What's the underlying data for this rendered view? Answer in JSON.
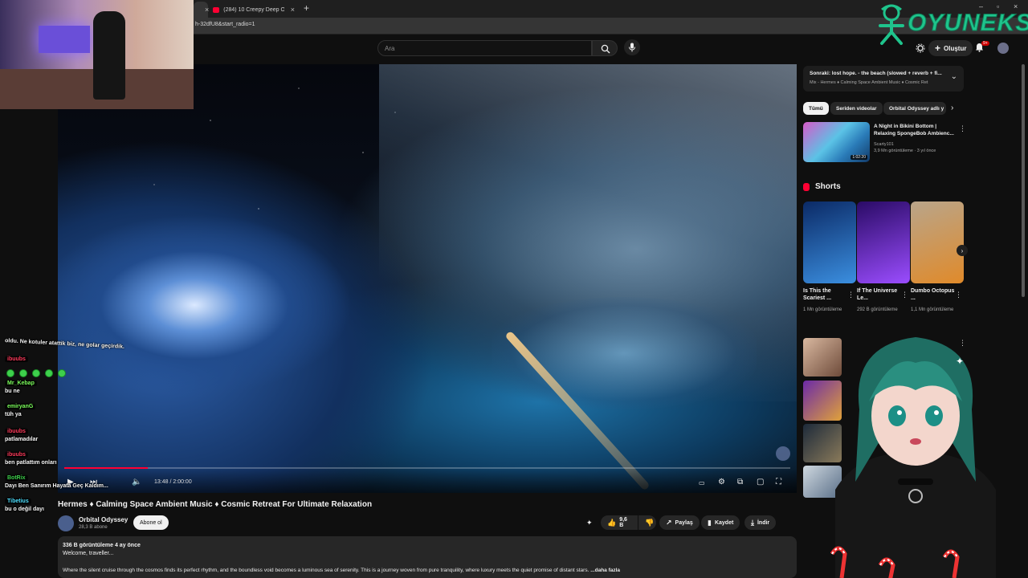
{
  "browser": {
    "tabs": [
      {
        "label": "",
        "active": true
      },
      {
        "label": "(284) 10 Creepy Deep Ocean C",
        "active": false
      }
    ],
    "url": "h-32dfU8&start_radio=1",
    "window_controls": [
      "–",
      "▫",
      "×"
    ]
  },
  "topbar": {
    "search_placeholder": "Ara",
    "create_label": "Oluştur",
    "notification_badge": "9+"
  },
  "player": {
    "time": "13:48 / 2:00:00",
    "progress": 0.115
  },
  "video": {
    "title": "Hermes ♦ Calming Space Ambient Music ♦ Cosmic Retreat For Ultimate Relaxation",
    "channel": "Orbital Odyssey",
    "subscribers": "28,3 B abone",
    "subscribe_label": "Abone ol",
    "likes": "9,6 B",
    "share_label": "Paylaş",
    "save_label": "Kaydet",
    "download_label": "İndir",
    "description": {
      "meta": "336 B görüntüleme  4 ay önce",
      "line1": "Welcome, traveller...",
      "line2": "Where the silent cruise through the cosmos finds its perfect rhythm, and the boundless void becomes a luminous sea of serenity. This is a journey woven from pure tranquility, where luxury meets the quiet promise of distant stars.",
      "more_label": "...daha fazla"
    }
  },
  "sidebar": {
    "next": {
      "title": "Sonraki: lost hope. - the beach (slowed + reverb + fi...",
      "subtitle": "Mix - Hermes ♦ Calming Space Ambient Music ♦ Cosmic Ret"
    },
    "chips": [
      {
        "label": "Tümü",
        "selected": true
      },
      {
        "label": "Seriden videolar",
        "selected": false
      },
      {
        "label": "Orbital Odyssey adlı y",
        "selected": false
      }
    ],
    "recommendation": {
      "title": "A Night in Bikini Bottom | Relaxing SpongeBob Ambienc...",
      "channel": "Scarty101",
      "meta": "3,9 Mn görüntüleme · 3 yıl önce",
      "duration": "1:02:20"
    },
    "shorts_label": "Shorts",
    "shorts": [
      {
        "title": "Is This the Scariest ...",
        "views": "1 Mn görüntüleme",
        "color1": "#0b2a66",
        "color2": "#3b8fe0"
      },
      {
        "title": "If The Universe Le...",
        "views": "292 B görüntüleme",
        "color1": "#2a0b66",
        "color2": "#9b4dff"
      },
      {
        "title": "Dumbo Octopus ...",
        "views": "1,1 Mn görüntüleme",
        "color1": "#b9a58a",
        "color2": "#e08a2a"
      }
    ]
  },
  "chat": {
    "messages": [
      {
        "user": "",
        "text": "oldu. Ne kotuler atattik biz, ne golar geçirdik."
      },
      {
        "user": "ibuubs",
        "text": "",
        "color": "#ff3b5c"
      },
      {
        "user": "Mr_Kebap",
        "text": "bu ne",
        "color": "#7cff5c"
      },
      {
        "user": "emiryanG",
        "text": "tüh ya",
        "color": "#7cff5c"
      },
      {
        "user": "ibuubs",
        "text": "patlamadılar",
        "color": "#ff3b5c"
      },
      {
        "user": "ibuubs",
        "text": "ben patlattım onları",
        "color": "#ff3b5c"
      },
      {
        "user": "BotRix",
        "text": "Dayı Ben Sanırım Hayata Geç Kaldım...",
        "color": "#3ecf4c"
      },
      {
        "user": "Tibetius",
        "text": "bu o değil dayı",
        "color": "#4ee0ff"
      }
    ]
  },
  "overlay": {
    "logo_text": "OYUNEKS"
  },
  "colors": {
    "yt_red": "#ff0033",
    "bg": "#0f0f0f",
    "surface": "#272727",
    "logo_green": "#1fc48c"
  }
}
